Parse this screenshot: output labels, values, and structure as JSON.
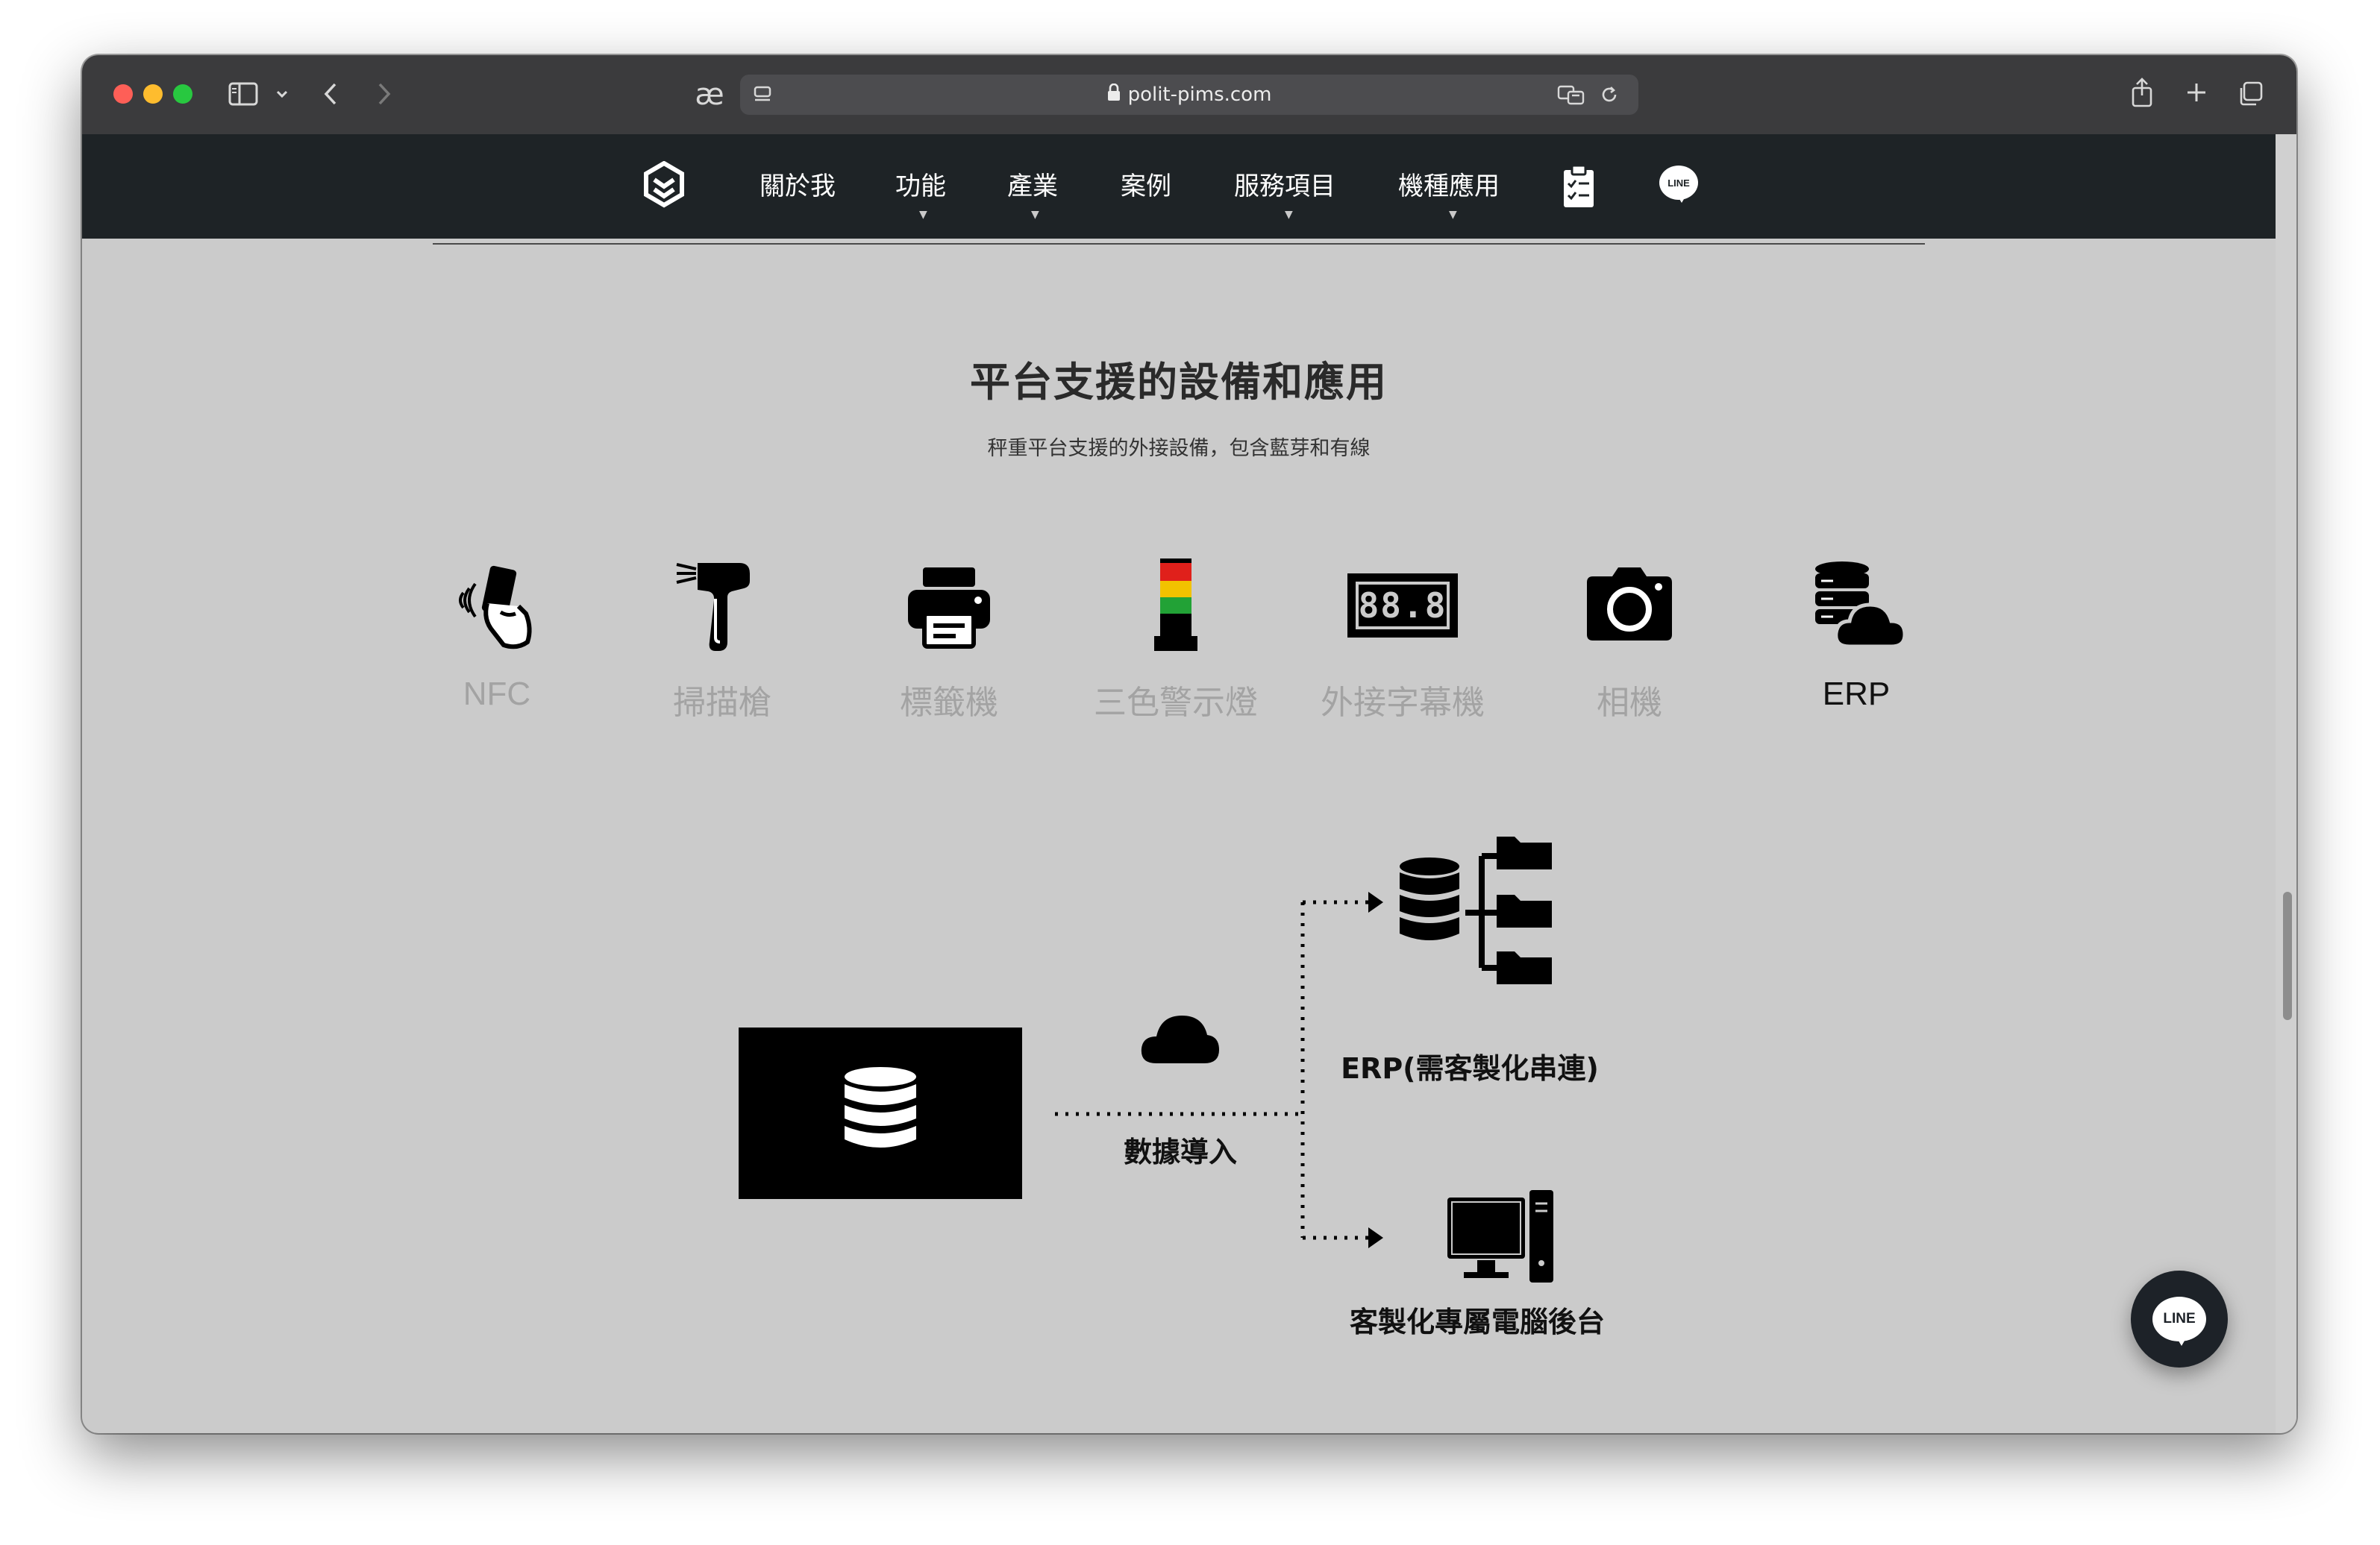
{
  "browser": {
    "url": "polit-pims.com",
    "reader_glyph": "æ"
  },
  "nav": {
    "items": [
      {
        "label": "關於我",
        "dropdown": false
      },
      {
        "label": "功能",
        "dropdown": true
      },
      {
        "label": "產業",
        "dropdown": true
      },
      {
        "label": "案例",
        "dropdown": false
      },
      {
        "label": "服務項目",
        "dropdown": true
      },
      {
        "label": "機種應用",
        "dropdown": true
      }
    ],
    "caret": "▼",
    "line_badge": "LINE"
  },
  "section": {
    "title": "平台支援的設備和應用",
    "subtitle": "秤重平台支援的外接設備，包含藍芽和有線"
  },
  "devices": [
    {
      "label": "NFC",
      "icon": "nfc-card-icon",
      "active": false
    },
    {
      "label": "掃描槍",
      "icon": "barcode-scanner-icon",
      "active": false
    },
    {
      "label": "標籤機",
      "icon": "printer-icon",
      "active": false
    },
    {
      "label": "三色警示燈",
      "icon": "tower-light-icon",
      "active": false
    },
    {
      "label": "外接字幕機",
      "icon": "led-display-icon",
      "active": false
    },
    {
      "label": "相機",
      "icon": "camera-icon",
      "active": false
    },
    {
      "label": "ERP",
      "icon": "database-cloud-icon",
      "active": true
    }
  ],
  "led_text": "88.8",
  "diagram": {
    "import_label": "數據導入",
    "erp_label": "ERP(需客製化串連)",
    "backend_label": "客製化專屬電腦後台"
  },
  "floating": {
    "line_label": "LINE"
  },
  "colors": {
    "nav_bg": "#1e2326",
    "page_bg": "#cbcbcb",
    "light_red": "#e0201b",
    "light_yellow": "#f2c200",
    "light_green": "#22a236"
  }
}
